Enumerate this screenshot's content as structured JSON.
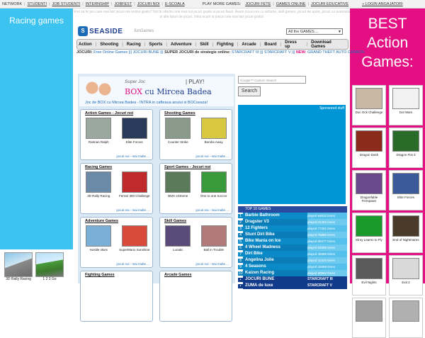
{
  "topnav": {
    "items": [
      "NETWORK",
      "STUDENTI",
      "JOB STUDENTI",
      "INTERNSHIP",
      "JOBFEST",
      "JOCURI NOI",
      "E-SCOALA"
    ],
    "play_more": "PLAY MORE GAMES:",
    "right_items": [
      "JOCURI FETE",
      "GAMES ONLINE",
      "JOCURI EDUCATIVE"
    ],
    "login": "» LOGIN ANGAJATORI"
  },
  "left": {
    "title": "Racing games",
    "thumbs": [
      {
        "label": "3D Rally Racing"
      },
      {
        "label": "1 2 3 Go"
      }
    ]
  },
  "right": {
    "heading": "BEST Action Games:",
    "games": [
      {
        "label": "Doc Ock Challenge",
        "color": "#c7b9a3"
      },
      {
        "label": "Dot Wars",
        "color": "#f2f2f2"
      },
      {
        "label": "Dragon Dash",
        "color": "#8b2b1c"
      },
      {
        "label": "Dragon Fist 3",
        "color": "#2a6b2a"
      },
      {
        "label": "Dragonfable Firespawn",
        "color": "#6a4a8a"
      },
      {
        "label": "Elite Forces",
        "color": "#3a5a9a"
      },
      {
        "label": "Elroy Learns to Fly",
        "color": "#1a9a2a"
      },
      {
        "label": "End of Nightmares",
        "color": "#4a3a2a"
      },
      {
        "label": "Evil Nights",
        "color": "#5a5a5a"
      },
      {
        "label": "Exit 2",
        "color": "#d9d9d9"
      },
      {
        "label": "",
        "color": "#a0a0a0"
      },
      {
        "label": "",
        "color": "#b0b0b0"
      }
    ]
  },
  "main": {
    "promo": "Vrei sa te joci cele mai tari jocuri noi online gratis? Noi iti oferim cele mai noi jocuri gratis si jocuri flash. Avem jocuri noi cu actiune, skill games, jocuri de sport, jocuri cu aventura si alte tipuri de jocuri. Intra acum si joaca cele mai tari jocuri gratis!",
    "logo": "SEASIDE",
    "logo_small": "funGames",
    "game_select": "All the GAMES....",
    "categories": [
      "Action",
      "Shooting",
      "Racing",
      "Sports",
      "Adventure",
      "Skill",
      "Fighting",
      "Arcade",
      "Board",
      "Dress up",
      "Download Games"
    ],
    "jocuri_line": {
      "label": "JOCURI:",
      "a": "Free Online Games",
      "b": "JOCURI BUNE",
      "c": "SUPER JOCURI de strategie online:",
      "d": "STARCRAFT III",
      "e": "STARCRAFT V",
      "new": "NEW:",
      "f": "GRAND THEFT AUTO CARBON"
    },
    "promo_box": {
      "super": "Super Joc",
      "play": "| PLAY!",
      "title_a": "BOX",
      "title_b": " cu Mircea Badea",
      "sub": "Joc de BOX cu Mircea Badea - INTRA in cafteaua anului si BOCseaza!"
    },
    "boxes": [
      {
        "title": "Action Games - Jocuri noi",
        "items": [
          {
            "label": "Ratman Ralph",
            "color": "#9aa8a0"
          },
          {
            "label": "Elite Forces",
            "color": "#2a3a5a"
          }
        ],
        "more": "jocuri noi - mai multe ..."
      },
      {
        "title": "Shooting Games",
        "items": [
          {
            "label": "Counter Strike",
            "color": "#8a9a8a"
          },
          {
            "label": "Bombs Away",
            "color": "#d8c840"
          }
        ],
        "more": "jocuri noi - mai multe ..."
      },
      {
        "title": "Racing Games",
        "items": [
          {
            "label": "3D Rally Racing",
            "color": "#6a8aa8"
          },
          {
            "label": "Ferrari 360 Challenge",
            "color": "#c02a2a"
          }
        ],
        "more": "jocuri noi - mai multe ..."
      },
      {
        "title": "Sport Games - Jocuri noi",
        "items": [
          {
            "label": "BMX eXtreme",
            "color": "#5a7a5a"
          },
          {
            "label": "One to one Soccer",
            "color": "#3a9a3a"
          }
        ],
        "more": "jocuri noi - mai multe ..."
      },
      {
        "title": "Adventure Games",
        "items": [
          {
            "label": "Hostile skies",
            "color": "#7ab0d8"
          },
          {
            "label": "SuperMario Sunshine",
            "color": "#d84a3a"
          }
        ],
        "more": "jocuri noi - mai multe ..."
      },
      {
        "title": "Skill Games",
        "items": [
          {
            "label": "Lunatic",
            "color": "#5a4a7a"
          },
          {
            "label": "Ball in Trouble",
            "color": "#b07a7a"
          }
        ],
        "more": "jocuri noi - mai multe ..."
      },
      {
        "title": "Fighting Games",
        "items": [],
        "more": ""
      },
      {
        "title": "Arcade Games",
        "items": [],
        "more": ""
      }
    ],
    "search": {
      "placeholder": "Google™ Custom Search",
      "button": "Search"
    },
    "sponsored": "Sponsored stuff",
    "top10": {
      "header": "TOP 10 GAMES",
      "rows": [
        {
          "n": "1",
          "game": "Barbie Bathroom",
          "plays": "played 93010 times"
        },
        {
          "n": "2",
          "game": "Dragster V3",
          "plays": "played 81284 times"
        },
        {
          "n": "3",
          "game": "12 Fighters",
          "plays": "played 77451 times"
        },
        {
          "n": "4",
          "game": "Stunt Dirt Bike",
          "plays": "played 76880 times"
        },
        {
          "n": "5",
          "game": "Bike Mania on Ice",
          "plays": "played 66477 times"
        },
        {
          "n": "6",
          "game": "4 Wheel Madness",
          "plays": "played 54595 times"
        },
        {
          "n": "7",
          "game": "Dirt Bike",
          "plays": "played 45880 times"
        },
        {
          "n": "8",
          "game": "Angelina Jolie",
          "plays": "played 41420 times"
        },
        {
          "n": "9",
          "game": "4 Seasons",
          "plays": "played 33069 times"
        },
        {
          "n": "10",
          "game": "Kaizen Racing",
          "plays": "played 30862 times"
        }
      ],
      "extra": [
        {
          "n": "•",
          "game": "JOCURI BUNE",
          "plays": "STARCRAFT III"
        },
        {
          "n": "•",
          "game": "ZUMA de luxe",
          "plays": "STARCRAFT V"
        }
      ]
    }
  }
}
